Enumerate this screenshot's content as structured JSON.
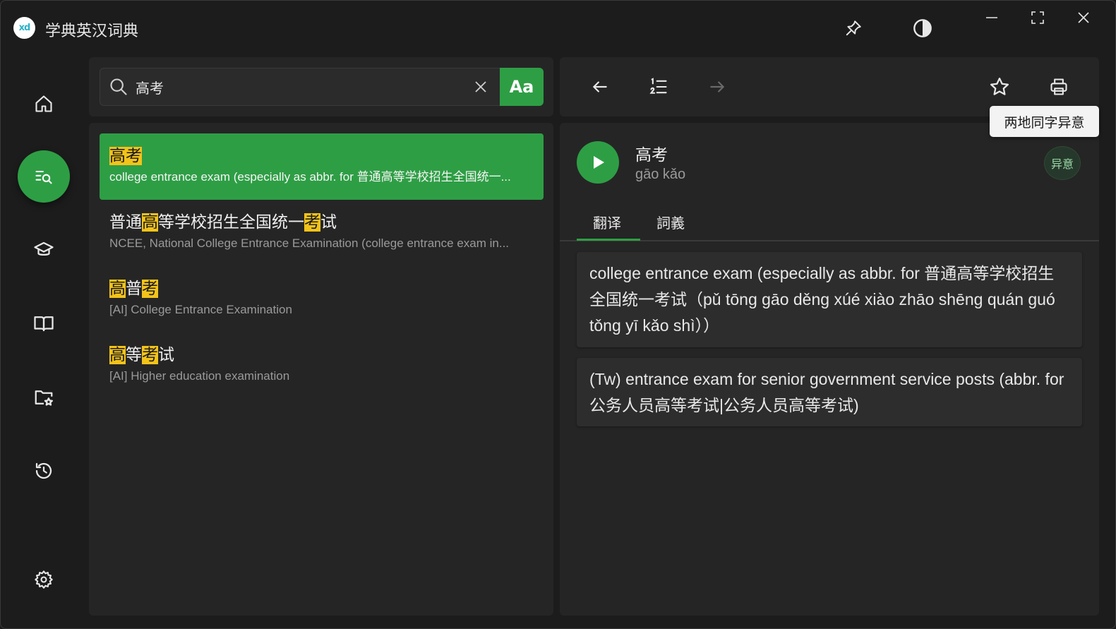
{
  "app": {
    "title": "学典英汉词典",
    "logo_text": "xd"
  },
  "titlebar": {
    "icons": [
      "pin-icon",
      "contrast-icon",
      "minimize-icon",
      "fullscreen-icon",
      "close-icon"
    ]
  },
  "nav": {
    "items": [
      {
        "name": "home",
        "icon": "home-icon"
      },
      {
        "name": "search",
        "icon": "search-list-icon",
        "active": true
      },
      {
        "name": "learn",
        "icon": "graduation-cap-icon"
      },
      {
        "name": "book",
        "icon": "book-open-icon"
      },
      {
        "name": "favorites",
        "icon": "folder-star-icon"
      },
      {
        "name": "history",
        "icon": "history-icon"
      },
      {
        "name": "settings",
        "icon": "gear-icon"
      }
    ]
  },
  "search": {
    "value": "高考",
    "placeholder": "",
    "case_button_label": "Aa"
  },
  "results": [
    {
      "title_parts": [
        {
          "t": "高",
          "hl": true
        },
        {
          "t": "考",
          "hl": true
        }
      ],
      "desc": "college entrance exam (especially as abbr. for 普通高等学校招生全国统一...",
      "selected": true
    },
    {
      "title_parts": [
        {
          "t": "普通",
          "hl": false
        },
        {
          "t": "高",
          "hl": true
        },
        {
          "t": "等学校招生全国统一",
          "hl": false
        },
        {
          "t": "考",
          "hl": true
        },
        {
          "t": "试",
          "hl": false
        }
      ],
      "desc": "NCEE, National College Entrance Examination (college entrance exam in...",
      "selected": false
    },
    {
      "title_parts": [
        {
          "t": "高",
          "hl": true
        },
        {
          "t": "普",
          "hl": false
        },
        {
          "t": "考",
          "hl": true
        }
      ],
      "desc": "[AI] College Entrance Examination",
      "selected": false
    },
    {
      "title_parts": [
        {
          "t": "高",
          "hl": true
        },
        {
          "t": "等",
          "hl": false
        },
        {
          "t": "考",
          "hl": true
        },
        {
          "t": "试",
          "hl": false
        }
      ],
      "desc": "[AI] Higher education examination",
      "selected": false
    }
  ],
  "toolbar": {
    "icons": [
      "back-arrow-icon",
      "numbered-list-icon",
      "forward-arrow-icon",
      "star-icon",
      "printer-icon"
    ],
    "tooltip": "两地同字异意"
  },
  "entry": {
    "headword": "高考",
    "pinyin": "gāo kǎo",
    "badge": "异意",
    "tabs": [
      {
        "label": "翻译",
        "active": true
      },
      {
        "label": "詞義",
        "active": false
      }
    ],
    "definitions": [
      "college entrance exam (especially as abbr. for 普通高等学校招生全国统一考试（pǔ tōng gāo děng xúé xiào zhāo shēng quán guó tǒng yī kǎo shì））",
      "(Tw) entrance exam for senior government service posts (abbr. for 公务人员高等考试|公务人员高等考试)"
    ]
  },
  "colors": {
    "accent": "#2e9e45",
    "highlight": "#f2c31a",
    "background": "#1c1c1c",
    "panel": "#252525"
  }
}
